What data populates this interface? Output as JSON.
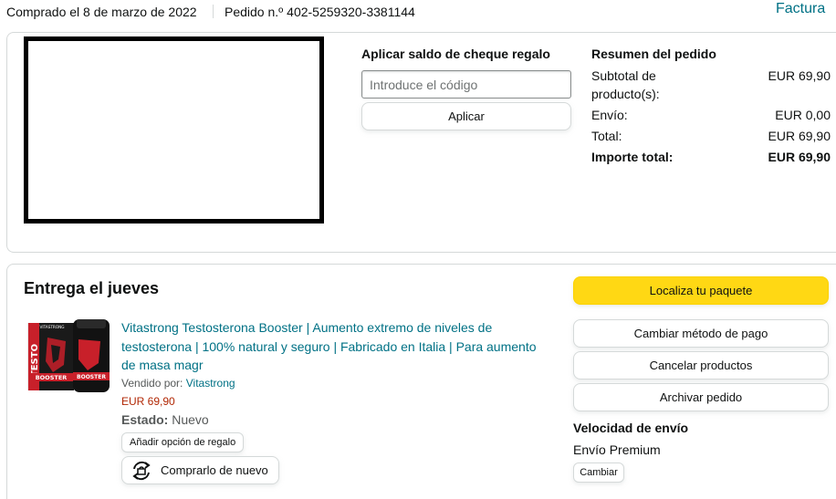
{
  "header": {
    "purchase_date": "Comprado el 8 de marzo de 2022",
    "order_number": "Pedido n.º 402-5259320-3381144",
    "invoice_link": "Factura"
  },
  "gift_card": {
    "title": "Aplicar saldo de cheque regalo",
    "input_placeholder": "Introduce el código",
    "apply_label": "Aplicar"
  },
  "summary": {
    "title": "Resumen del pedido",
    "rows": [
      {
        "label": "Subtotal de producto(s):",
        "value": "EUR 69,90"
      },
      {
        "label": "Envío:",
        "value": "EUR 0,00"
      },
      {
        "label": "Total:",
        "value": "EUR 69,90"
      }
    ],
    "grand_total": {
      "label": "Importe total:",
      "value": "EUR 69,90"
    }
  },
  "delivery": {
    "title": "Entrega el jueves",
    "product": {
      "title": "Vitastrong Testosterona Booster | Aumento extremo de niveles de testosterona | 100% natural y seguro | Fabricado en Italia | Para aumento de masa magr",
      "sold_by_label": "Vendido por:",
      "seller": "Vitastrong",
      "price": "EUR 69,90",
      "state_label": "Estado:",
      "state_value": "Nuevo",
      "gift_option_label": "Añadir opción de regalo",
      "buy_again_label": "Comprarlo de nuevo",
      "image_text": {
        "brand": "VITASTRONG",
        "vertical": "TESTO",
        "band": "BOOSTER"
      }
    },
    "actions": {
      "track": "Localiza tu paquete",
      "change_payment": "Cambiar método de pago",
      "cancel": "Cancelar productos",
      "archive": "Archivar pedido"
    },
    "shipping": {
      "title": "Velocidad de envío",
      "value": "Envío Premium",
      "change_label": "Cambiar"
    }
  },
  "colors": {
    "link": "#007185",
    "price": "#b12704",
    "primary_button": "#ffd814",
    "border": "#d5d9d9"
  }
}
